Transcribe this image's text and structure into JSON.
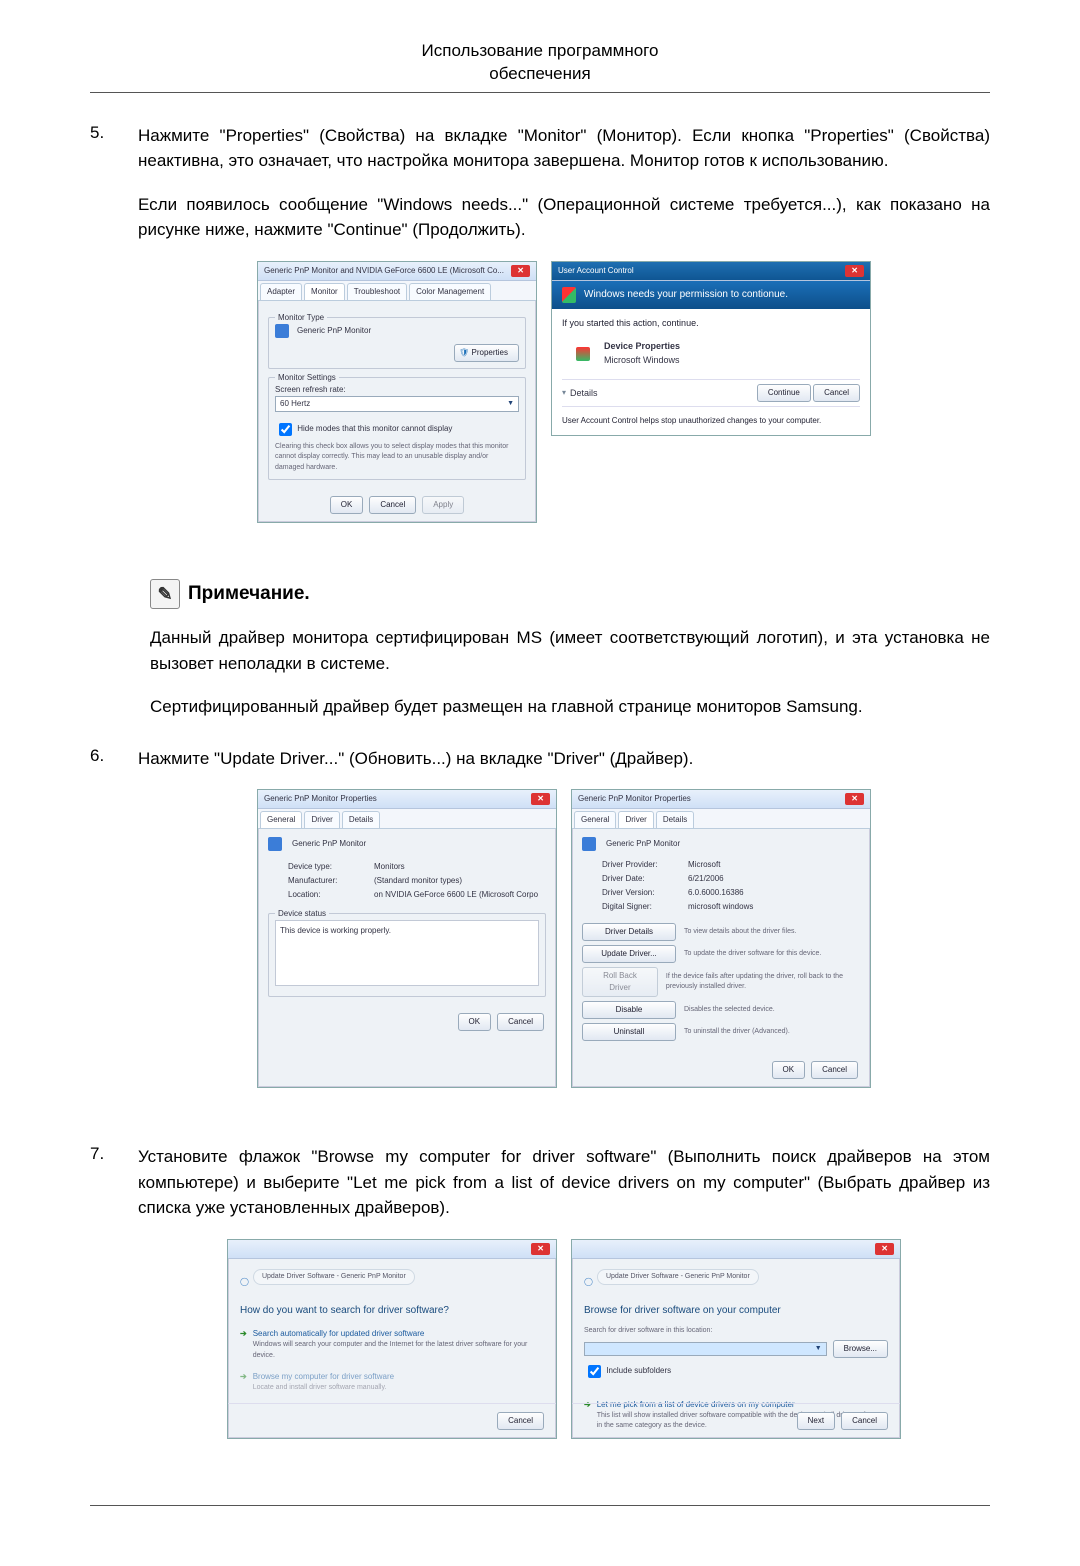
{
  "header": {
    "line1": "Использование программного",
    "line2": "обеспечения"
  },
  "steps": {
    "s5": {
      "n": "5.",
      "p1": "Нажмите \"Properties\" (Свойства) на вкладке \"Monitor\" (Монитор). Если кнопка \"Properties\" (Свойства) неактивна, это означает, что настройка монитора завершена. Монитор готов к использованию.",
      "p2": "Если появилось сообщение \"Windows needs...\" (Операционной системе требуется...), как показано на рисунке ниже, нажмите \"Continue\" (Продолжить)."
    },
    "s6": {
      "n": "6.",
      "p1": "Нажмите \"Update Driver...\" (Обновить...) на вкладке \"Driver\" (Драйвер)."
    },
    "s7": {
      "n": "7.",
      "p1": "Установите флажок \"Browse my computer for driver software\" (Выполнить поиск драйверов на этом компьютере) и выберите \"Let me pick from a list of device drivers on my computer\" (Выбрать драйвер из списка уже установленных драйверов)."
    }
  },
  "note": {
    "heading": "Примечание.",
    "p1": "Данный драйвер монитора сертифицирован MS (имеет соответствующий логотип), и эта установка не вызовет неполадки в системе.",
    "p2": "Сертифицированный драйвер будет размещен на главной странице мониторов Samsung."
  },
  "dlgA": {
    "title": "Generic PnP Monitor and NVIDIA GeForce 6600 LE (Microsoft Co...",
    "tabs": {
      "adapter": "Adapter",
      "monitor": "Monitor",
      "trouble": "Troubleshoot",
      "color": "Color Management"
    },
    "monitorTypeLegend": "Monitor Type",
    "monitorTypeValue": "Generic PnP Monitor",
    "propsBtn": "Properties",
    "settingsLegend": "Monitor Settings",
    "refreshLabel": "Screen refresh rate:",
    "refreshValue": "60 Hertz",
    "hideModes": "Hide modes that this monitor cannot display",
    "hideModesDesc": "Clearing this check box allows you to select display modes that this monitor cannot display correctly. This may lead to an unusable display and/or damaged hardware.",
    "ok": "OK",
    "cancel": "Cancel",
    "apply": "Apply"
  },
  "uac": {
    "title": "User Account Control",
    "banner": "Windows needs your permission to contionue.",
    "ifstarted": "If you started this action, continue.",
    "devprops": "Device Properties",
    "mswin": "Microsoft Windows",
    "details": "Details",
    "continueBtn": "Continue",
    "cancelBtn": "Cancel",
    "footer": "User Account Control helps stop unauthorized changes to your computer."
  },
  "dlgGen": {
    "title": "Generic PnP Monitor Properties",
    "tabs": {
      "general": "General",
      "driver": "Driver",
      "details": "Details"
    },
    "name": "Generic PnP Monitor",
    "devtype_k": "Device type:",
    "devtype_v": "Monitors",
    "manu_k": "Manufacturer:",
    "manu_v": "(Standard monitor types)",
    "loc_k": "Location:",
    "loc_v": "on NVIDIA GeForce 6600 LE (Microsoft Corpo",
    "statusLegend": "Device status",
    "statusText": "This device is working properly.",
    "ok": "OK",
    "cancel": "Cancel"
  },
  "dlgDrv": {
    "title": "Generic PnP Monitor Properties",
    "name": "Generic PnP Monitor",
    "prov_k": "Driver Provider:",
    "prov_v": "Microsoft",
    "date_k": "Driver Date:",
    "date_v": "6/21/2006",
    "ver_k": "Driver Version:",
    "ver_v": "6.0.6000.16386",
    "sign_k": "Digital Signer:",
    "sign_v": "microsoft windows",
    "btnDetails": "Driver Details",
    "txtDetails": "To view details about the driver files.",
    "btnUpdate": "Update Driver...",
    "txtUpdate": "To update the driver software for this device.",
    "btnRoll": "Roll Back Driver",
    "txtRoll": "If the device fails after updating the driver, roll back to the previously installed driver.",
    "btnDisable": "Disable",
    "txtDisable": "Disables the selected device.",
    "btnUninst": "Uninstall",
    "txtUninst": "To uninstall the driver (Advanced).",
    "ok": "OK",
    "cancel": "Cancel"
  },
  "wizA": {
    "crumb": "Update Driver Software - Generic PnP Monitor",
    "q": "How do you want to search for driver software?",
    "opt1": "Search automatically for updated driver software",
    "opt1d": "Windows will search your computer and the Internet for the latest driver software for your device.",
    "opt2": "Browse my computer for driver software",
    "opt2d": "Locate and install driver software manually.",
    "cancel": "Cancel"
  },
  "wizB": {
    "crumb": "Update Driver Software - Generic PnP Monitor",
    "h": "Browse for driver software on your computer",
    "searchLabel": "Search for driver software in this location:",
    "browse": "Browse...",
    "include": "Include subfolders",
    "opt": "Let me pick from a list of device drivers on my computer",
    "optd": "This list will show installed driver software compatible with the device, and all driver software in the same category as the device.",
    "next": "Next",
    "cancel": "Cancel"
  }
}
